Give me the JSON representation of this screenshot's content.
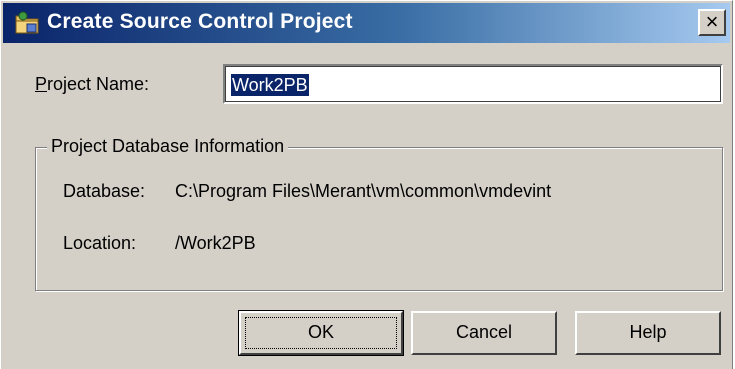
{
  "dialog": {
    "title": "Create Source Control Project",
    "close_glyph": "×",
    "icon": "source-control-project-icon"
  },
  "project_name": {
    "label_prefix_underlined": "P",
    "label_rest": "roject Name:",
    "value": "Work2PB"
  },
  "group": {
    "title": "Project Database Information",
    "database_label": "Database:",
    "database_value": "C:\\Program Files\\Merant\\vm\\common\\vmdevint",
    "location_label": "Location:",
    "location_value": "/Work2PB"
  },
  "buttons": {
    "ok": "OK",
    "cancel": "Cancel",
    "help": "Help"
  }
}
